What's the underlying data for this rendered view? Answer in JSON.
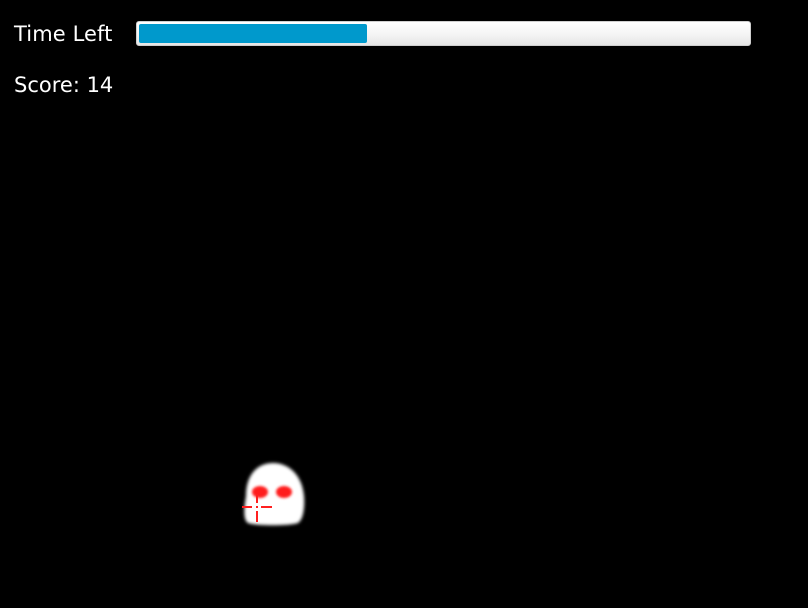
{
  "hud": {
    "time_label": "Time Left",
    "time_left_fraction": 0.375,
    "score_text": "Score: 14"
  },
  "colors": {
    "background": "#000000",
    "progress_fill": "#0099cc",
    "ghost_body": "#ffffff",
    "ghost_eyes": "#ff1a1a",
    "crosshair": "#ff2020"
  },
  "sprites": {
    "ghost": "ghost-target",
    "cursor": "crosshair-cursor"
  }
}
